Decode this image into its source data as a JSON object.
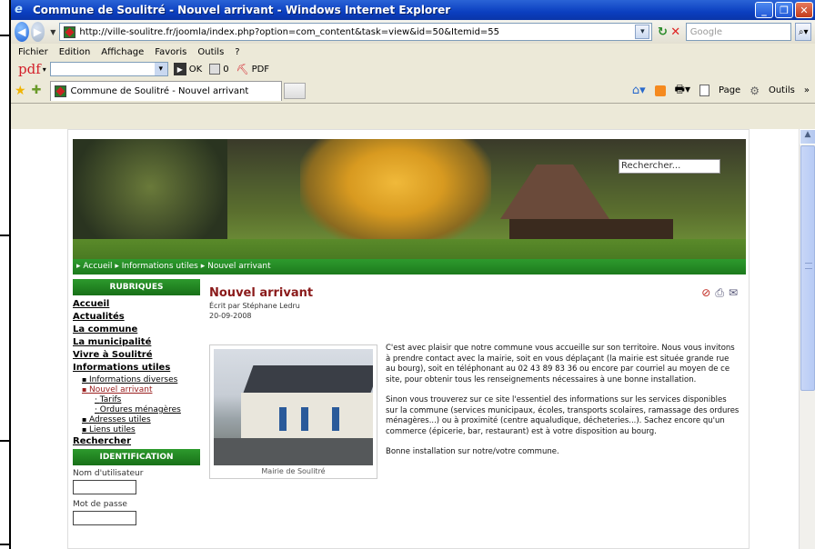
{
  "window": {
    "title": "Commune de Soulitré - Nouvel arrivant - Windows Internet Explorer"
  },
  "nav": {
    "url": "http://ville-soulitre.fr/joomla/index.php?option=com_content&task=view&id=50&Itemid=55",
    "search_placeholder": "Google"
  },
  "menu": [
    "Fichier",
    "Edition",
    "Affichage",
    "Favoris",
    "Outils",
    "?"
  ],
  "pdfbar": {
    "logo": "pdf",
    "ok_label": "OK",
    "count": "0",
    "pdf_label": "PDF"
  },
  "tab": {
    "title": "Commune de Soulitré - Nouvel arrivant"
  },
  "cmdbar": {
    "page_label": "Page",
    "tools_label": "Outils"
  },
  "site": {
    "search_placeholder": "Rechercher...",
    "breadcrumb": "▸ Accueil ▸ Informations utiles ▸ Nouvel arrivant",
    "sidebar": {
      "rubriques_head": "RUBRIQUES",
      "links": [
        "Accueil",
        "Actualités",
        "La commune",
        "La municipalité",
        "Vivre à Soulitré",
        "Informations utiles"
      ],
      "sub": {
        "informations_diverses": "Informations diverses",
        "nouvel_arrivant": "Nouvel arrivant",
        "tarifs": "Tarifs",
        "ordures": "Ordures ménagères",
        "adresses": "Adresses utiles",
        "liens": "Liens utiles"
      },
      "rechercher": "Rechercher",
      "identification_head": "IDENTIFICATION",
      "username_label": "Nom d'utilisateur",
      "password_label": "Mot de passe"
    },
    "article": {
      "title": "Nouvel arrivant",
      "author": "Écrit par Stéphane Ledru",
      "date": "20-09-2008",
      "photo_caption": "Mairie de Soulitré",
      "p1": "C'est avec plaisir que notre commune vous accueille sur son territoire. Nous vous invitons à prendre contact avec la mairie, soit en vous déplaçant (la mairie est située grande rue au bourg), soit en téléphonant au 02 43 89 83 36 ou encore par courriel au moyen de ce site, pour obtenir tous les renseignements nécessaires à une bonne installation.",
      "p2": "Sinon vous trouverez sur ce site l'essentiel des informations sur les services disponibles sur la commune (services municipaux, écoles, transports scolaires, ramassage des ordures ménagères...) ou à proximité (centre aqualudique, décheteries...). Sachez encore qu'un commerce (épicerie, bar, restaurant) est à votre disposition au bourg.",
      "p3": "Bonne installation sur notre/votre commune."
    }
  }
}
